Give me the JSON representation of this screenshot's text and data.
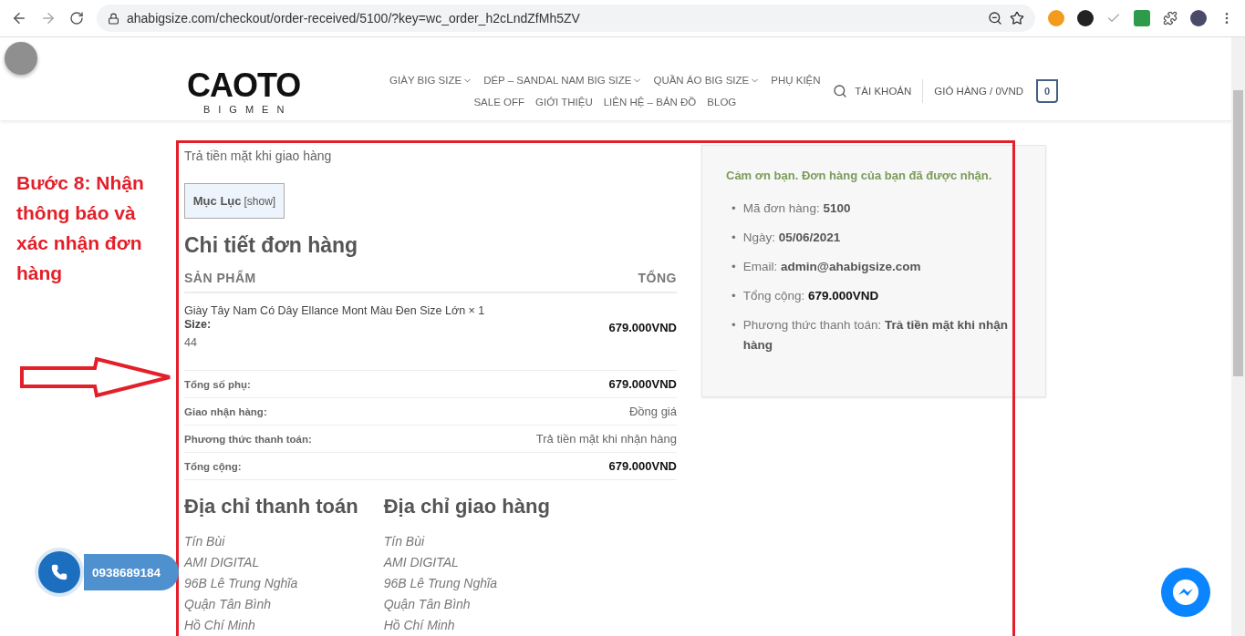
{
  "browser": {
    "url": "ahabigsize.com/checkout/order-received/5100/?key=wc_order_h2cLndZfMh5ZV"
  },
  "header": {
    "logo": {
      "title": "CAOTO",
      "subtitle": "BIGMEN"
    },
    "nav_rows": [
      [
        {
          "label": "GIÀY BIG SIZE",
          "has_dropdown": true
        },
        {
          "label": "DÉP – SANDAL NAM BIG SIZE",
          "has_dropdown": true
        },
        {
          "label": "QUẦN ÁO BIG SIZE",
          "has_dropdown": true
        },
        {
          "label": "PHỤ KIỆN",
          "has_dropdown": false
        }
      ],
      [
        {
          "label": "SALE OFF",
          "has_dropdown": false
        },
        {
          "label": "GIỚI THIỆU",
          "has_dropdown": false
        },
        {
          "label": "LIÊN HỆ – BẢN ĐỒ",
          "has_dropdown": false
        },
        {
          "label": "BLOG",
          "has_dropdown": false
        }
      ]
    ],
    "account": "TÀI KHOẢN",
    "cart": "GIỎ HÀNG / 0VND",
    "cart_count": "0"
  },
  "annotation": {
    "text": "Bước 8: Nhận thông báo và xác nhận đơn hàng"
  },
  "order": {
    "payment_note": "Trả tiền mặt khi giao hàng",
    "toc": {
      "title": "Mục Lục",
      "toggle": "[show]"
    },
    "heading": "Chi tiết đơn hàng",
    "columns": [
      "SẢN PHẨM",
      "TỔNG"
    ],
    "item": {
      "name": "Giày Tây Nam Có Dây Ellance Mont Màu Đen Size Lớn × 1",
      "size_label": "Size:",
      "size_value": "44",
      "total": "679.000VND"
    },
    "totals": [
      {
        "label": "Tổng số phụ:",
        "value": "679.000VND",
        "strong": true
      },
      {
        "label": "Giao nhận hàng:",
        "value": "Đồng giá",
        "strong": false
      },
      {
        "label": "Phương thức thanh toán:",
        "value": "Trả tiền mặt khi nhận hàng",
        "strong": false
      },
      {
        "label": "Tổng cộng:",
        "value": "679.000VND",
        "strong": true
      }
    ],
    "addresses": [
      {
        "heading": "Địa chỉ thanh toán",
        "lines": [
          "Tín Bùi",
          "AMI DIGITAL",
          "96B Lê Trung Nghĩa",
          "Quận Tân Bình",
          "Hồ Chí Minh"
        ]
      },
      {
        "heading": "Địa chỉ giao hàng",
        "lines": [
          "Tín Bùi",
          "AMI DIGITAL",
          "96B Lê Trung Nghĩa",
          "Quận Tân Bình",
          "Hồ Chí Minh"
        ]
      }
    ]
  },
  "summary": {
    "thanks": "Cảm ơn bạn. Đơn hàng của bạn đã được nhận.",
    "bullet": "•",
    "items": [
      {
        "label": "Mã đơn hàng:",
        "value": "5100",
        "highlight": false
      },
      {
        "label": "Ngày:",
        "value": "05/06/2021",
        "highlight": false
      },
      {
        "label": "Email:",
        "value": "admin@ahabigsize.com",
        "highlight": false
      },
      {
        "label": "Tổng cộng:",
        "value": "679.000VND",
        "highlight": true
      },
      {
        "label": "Phương thức thanh toán:",
        "value": "Trả tiền mặt khi nhận hàng",
        "highlight": false
      }
    ]
  },
  "call_widget": {
    "phone": "0938689184"
  }
}
